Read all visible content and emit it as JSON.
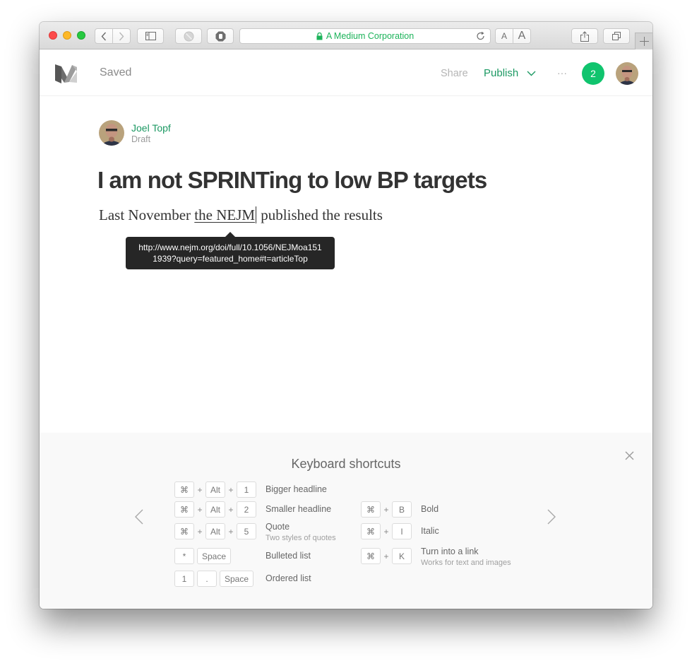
{
  "browser": {
    "url_display": "A Medium Corporation",
    "text_size_small": "A",
    "text_size_large": "A",
    "colors": {
      "url_green": "#1cb35a"
    }
  },
  "header": {
    "status": "Saved",
    "share_label": "Share",
    "publish_label": "Publish",
    "more_label": "···",
    "notification_count": "2",
    "colors": {
      "accent": "#1c9963",
      "badge": "#10c46e"
    }
  },
  "post": {
    "author_name": "Joel Topf",
    "author_status": "Draft",
    "title": "I am not SPRINTing to low BP targets",
    "body_before": "Last November ",
    "body_link": "the NEJM",
    "body_after": " published the results",
    "link_tooltip_line1": "http://www.nejm.org/doi/full/10.1056/NEJMoa151",
    "link_tooltip_line2": "1939?query=featured_home#t=articleTop"
  },
  "shortcuts": {
    "title": "Keyboard shortcuts",
    "left": [
      {
        "keys": [
          "⌘",
          "+",
          "Alt",
          "+",
          "1"
        ],
        "label": "Bigger headline",
        "sub": ""
      },
      {
        "keys": [
          "⌘",
          "+",
          "Alt",
          "+",
          "2"
        ],
        "label": "Smaller headline",
        "sub": ""
      },
      {
        "keys": [
          "⌘",
          "+",
          "Alt",
          "+",
          "5"
        ],
        "label": "Quote",
        "sub": "Two styles of quotes"
      },
      {
        "keys": [
          "*",
          "Space"
        ],
        "label": "Bulleted list",
        "sub": ""
      },
      {
        "keys": [
          "1",
          ".",
          "Space"
        ],
        "label": "Ordered list",
        "sub": ""
      }
    ],
    "right": [
      {
        "keys": [
          "⌘",
          "+",
          "B"
        ],
        "label": "Bold",
        "sub": ""
      },
      {
        "keys": [
          "⌘",
          "+",
          "I"
        ],
        "label": "Italic",
        "sub": ""
      },
      {
        "keys": [
          "⌘",
          "+",
          "K"
        ],
        "label": "Turn into a link",
        "sub": "Works for text and images"
      }
    ]
  }
}
